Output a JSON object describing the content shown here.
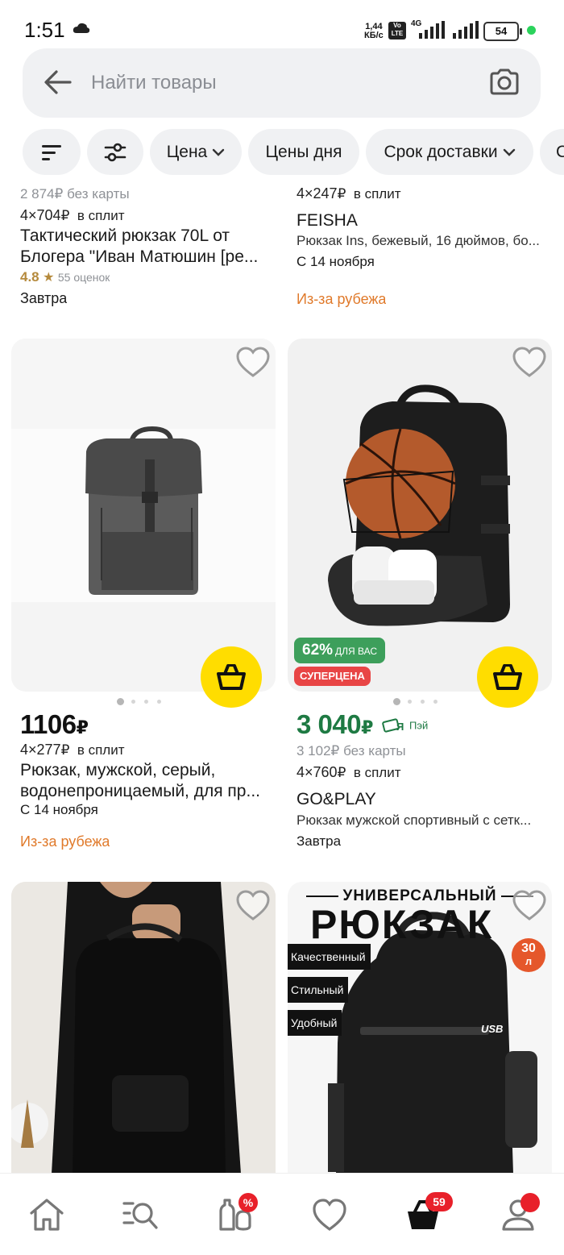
{
  "status_bar": {
    "time": "1:51",
    "net_speed_value": "1,44",
    "net_speed_unit": "КБ/с",
    "volte_top": "Vo",
    "volte_bottom": "LTE",
    "network_type": "4G",
    "battery": "54"
  },
  "search": {
    "placeholder": "Найти товары"
  },
  "filters": {
    "price_label": "Цена",
    "deals_label": "Цены дня",
    "delivery_label": "Срок доставки",
    "next_chip_initial": "С"
  },
  "products": [
    {
      "old_price": "2 874",
      "currency": "₽",
      "old_price_note": "без карты",
      "split_text": "4×704",
      "split_note": "в сплит",
      "title_line1": "Тактический рюкзак 70L от",
      "title_line2": "Блогера \"Иван Матюшин [ре...",
      "rating": "4.8",
      "reviews": "55 оценок",
      "delivery": "Завтра"
    },
    {
      "split_text": "4×247",
      "split_note": "в сплит",
      "brand": "FEISHA",
      "title": "Рюкзак Ins, бежевый, 16 дюймов, бо...",
      "delivery": "С 14 ноября",
      "origin": "Из-за рубежа"
    },
    {
      "price": "1106",
      "split_text": "4×277",
      "split_note": "в сплит",
      "title_line1": "Рюкзак, мужской, серый,",
      "title_line2": "водонепроницаемый, для пр...",
      "delivery": "С 14 ноября",
      "origin": "Из-за рубежа"
    },
    {
      "discount_badge": "62%",
      "discount_badge_note": "ДЛЯ ВАС",
      "super_badge": "СУПЕРЦЕНА",
      "price": "3 040",
      "pay_label": "Пэй",
      "old_price": "3 102",
      "old_price_note": "без карты",
      "split_text": "4×760",
      "split_note": "в сплит",
      "brand": "GO&PLAY",
      "title": "Рюкзак мужской спортивный с сетк...",
      "delivery": "Завтра"
    },
    {},
    {
      "promo_header": "УНИВЕРСАЛЬНЫЙ",
      "promo_title": "РЮКЗАК",
      "promo_item1": "Качественный",
      "promo_item2": "Стильный",
      "promo_item3": "Удобный",
      "promo_volume": "30",
      "promo_volume_unit": "л",
      "usb_label": "USB"
    }
  ],
  "bottom_nav": {
    "discount_badge": "%",
    "cart_count": "59"
  },
  "colors": {
    "accent_yellow": "#ffdd00",
    "green_price": "#1e7a43",
    "orange_origin": "#e07a2b",
    "badge_red": "#e84545",
    "chip_bg": "#f0f1f3"
  }
}
